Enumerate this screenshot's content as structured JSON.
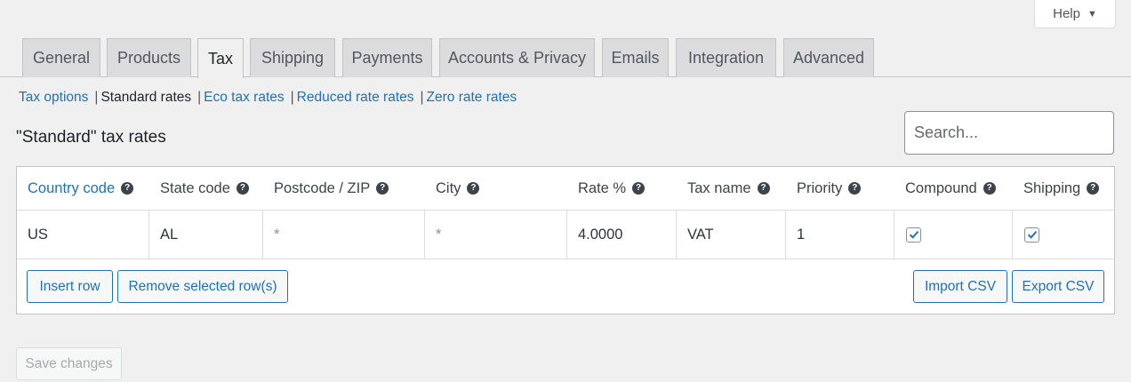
{
  "help": {
    "label": "Help"
  },
  "tabs": [
    {
      "label": "General"
    },
    {
      "label": "Products"
    },
    {
      "label": "Tax",
      "active": true
    },
    {
      "label": "Shipping"
    },
    {
      "label": "Payments"
    },
    {
      "label": "Accounts & Privacy"
    },
    {
      "label": "Emails"
    },
    {
      "label": "Integration"
    },
    {
      "label": "Advanced"
    }
  ],
  "subnav": {
    "tax_options": "Tax options",
    "standard_rates": "Standard rates",
    "eco_tax_rates": "Eco tax rates",
    "reduced_rate_rates": "Reduced rate rates",
    "zero_rate_rates": "Zero rate rates",
    "separator": "|"
  },
  "heading": "\"Standard\" tax rates",
  "search": {
    "placeholder": "Search..."
  },
  "table": {
    "columns": [
      "Country code",
      "State code",
      "Postcode / ZIP",
      "City",
      "Rate %",
      "Tax name",
      "Priority",
      "Compound",
      "Shipping"
    ],
    "rows": [
      {
        "country": "US",
        "state": "AL",
        "postcode": "*",
        "city": "*",
        "rate": "4.0000",
        "tax_name": "VAT",
        "priority": "1",
        "compound": true,
        "shipping": true
      }
    ],
    "help_glyph": "?"
  },
  "buttons": {
    "insert_row": "Insert row",
    "remove_rows": "Remove selected row(s)",
    "import_csv": "Import CSV",
    "export_csv": "Export CSV",
    "save_changes": "Save changes"
  },
  "colors": {
    "link": "#2271b1",
    "background": "#f0f0f1",
    "tab_inactive": "#dcdcde"
  }
}
